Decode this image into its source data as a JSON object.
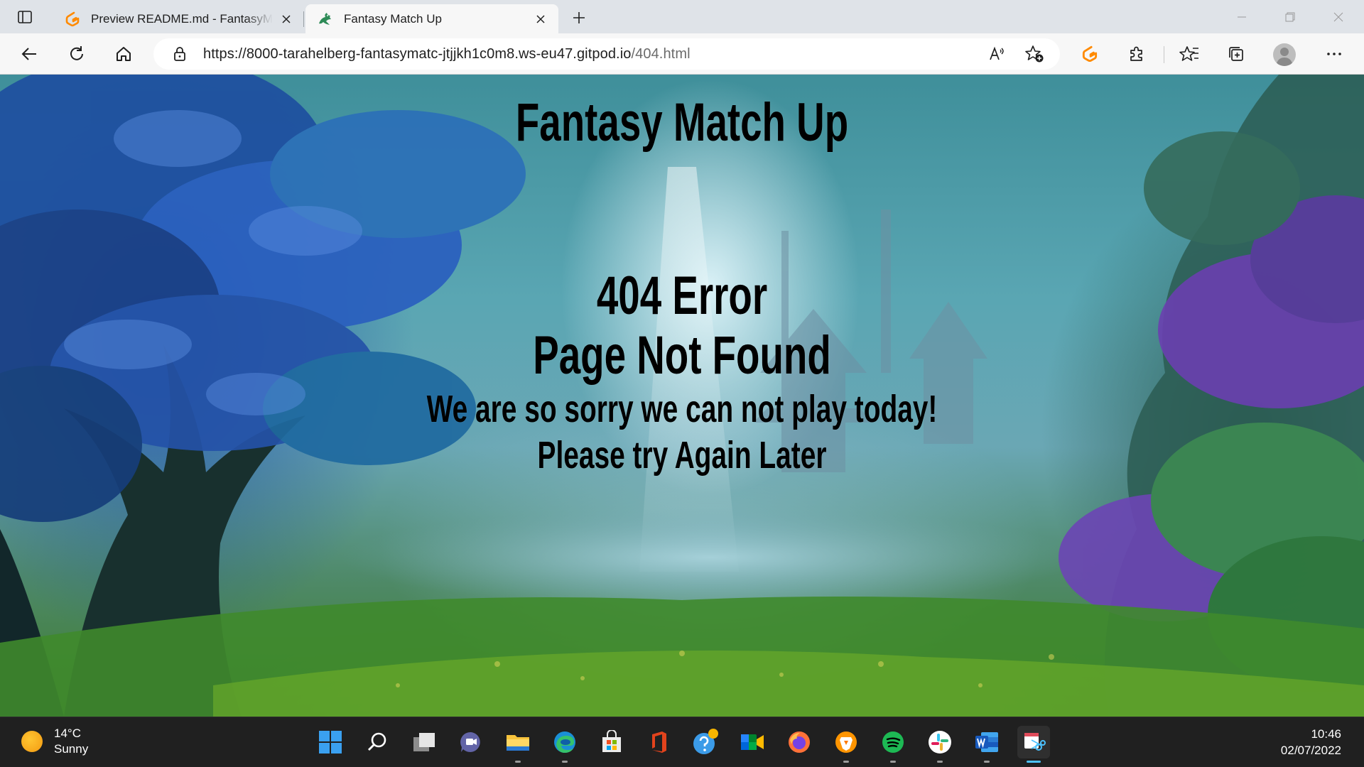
{
  "browser": {
    "tabs": [
      {
        "title": "Preview README.md - FantasyMatchUp",
        "favicon": "gitpod-icon",
        "active": false
      },
      {
        "title": "Fantasy Match Up",
        "favicon": "dragon-icon",
        "active": true
      }
    ],
    "url_host": "https://8000-tarahelberg-fantasymatc-jtjjkh1c0m8.ws-eu47.gitpod.io",
    "url_path": "/404.html",
    "colors": {
      "tabstrip": "#dfe3e8",
      "toolbar": "#f7f7f7",
      "accent": "#f5a623"
    }
  },
  "page": {
    "title": "Fantasy Match Up",
    "error_code": "404 Error",
    "error_text": "Page Not Found",
    "sorry_text": "We are so sorry we can not play today!",
    "later_text": "Please try Again Later"
  },
  "taskbar": {
    "weather": {
      "temperature": "14°C",
      "condition": "Sunny"
    },
    "clock": {
      "time": "10:46",
      "date": "02/07/2022"
    },
    "apps": [
      "windows-start-icon",
      "search-icon",
      "task-view-icon",
      "teams-chat-icon",
      "file-explorer-icon",
      "edge-icon",
      "microsoft-store-icon",
      "office-icon",
      "help-icon",
      "meet-icon",
      "firefox-icon",
      "brave-icon",
      "spotify-icon",
      "slack-icon",
      "word-icon",
      "snipping-tool-icon"
    ]
  }
}
